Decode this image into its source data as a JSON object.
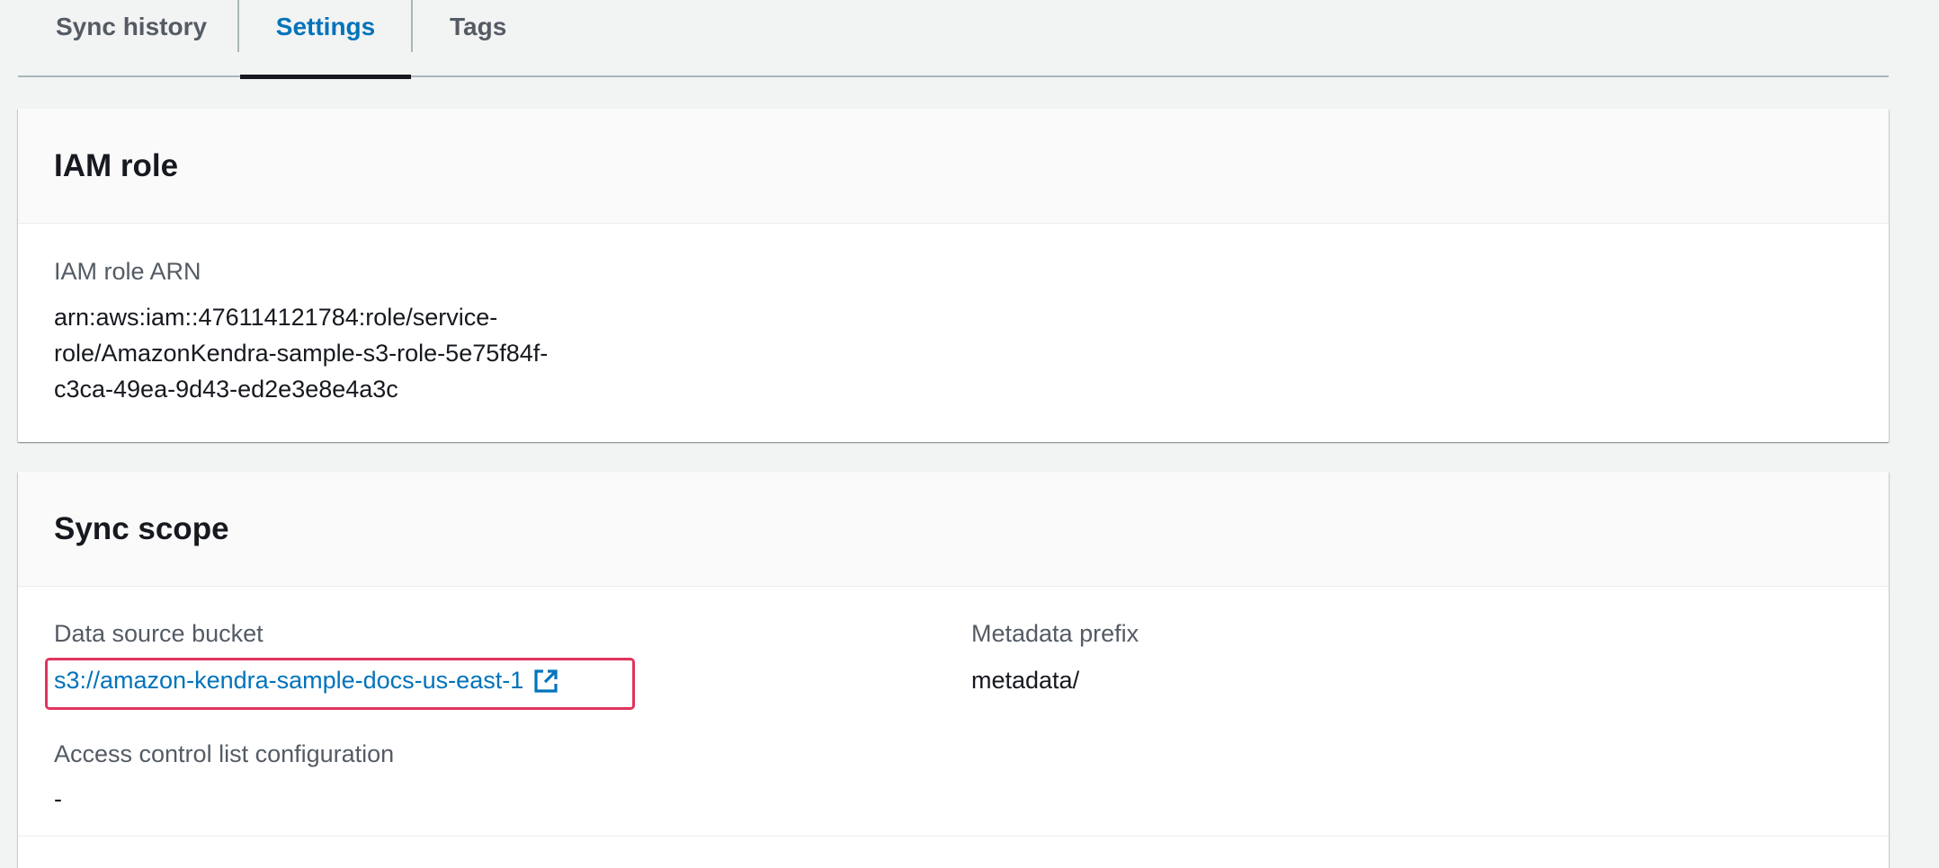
{
  "tabs": [
    {
      "label": "Sync history",
      "active": false
    },
    {
      "label": "Settings",
      "active": true
    },
    {
      "label": "Tags",
      "active": false
    }
  ],
  "iam_section": {
    "title": "IAM role",
    "arn_label": "IAM role ARN",
    "arn_lines": [
      "arn:aws:iam::476114121784:role/service-",
      "role/AmazonKendra-sample-s3-role-5e75f84f-",
      "c3ca-49ea-9d43-ed2e3e8e4a3c"
    ]
  },
  "sync_scope": {
    "title": "Sync scope",
    "bucket_label": "Data source bucket",
    "bucket_value": "s3://amazon-kendra-sample-docs-us-east-1",
    "bucket_icon": "external-link-icon",
    "metadata_label": "Metadata prefix",
    "metadata_value": "metadata/",
    "acl_label": "Access control list configuration",
    "acl_value": "-"
  },
  "colors": {
    "accent": "#0073bb",
    "highlight": "#e0345e",
    "background": "#f2f3f3"
  }
}
